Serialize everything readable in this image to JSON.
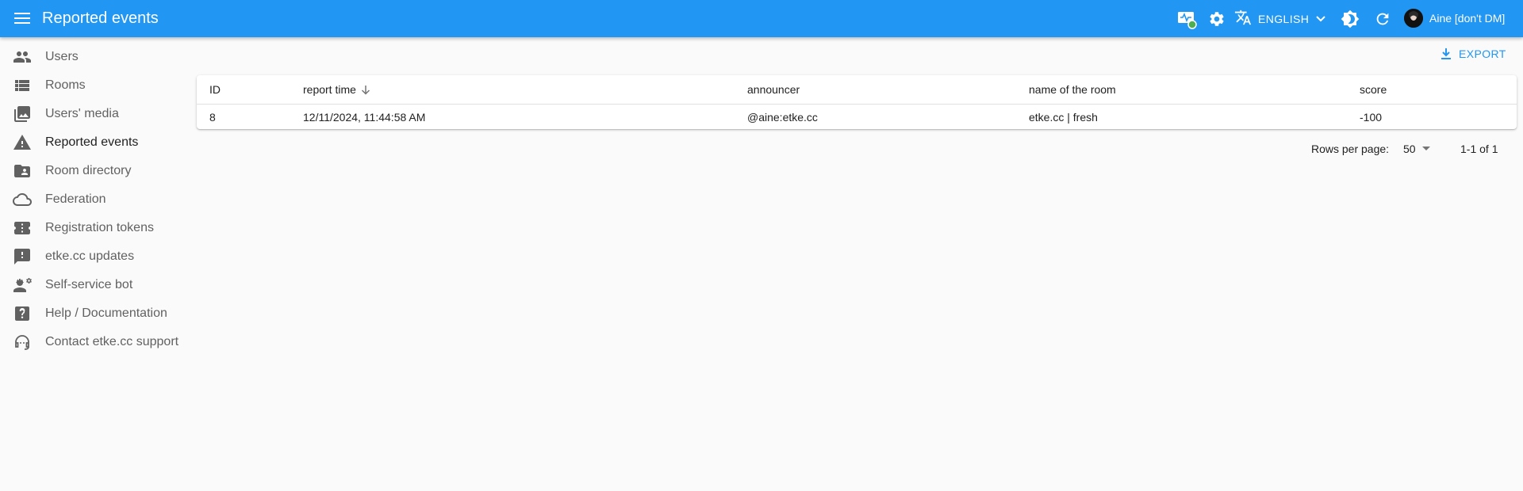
{
  "appbar": {
    "title": "Reported events",
    "language": "ENGLISH",
    "user_name": "Aine [don't DM]",
    "icons": [
      "menu-icon",
      "server-status-icon",
      "settings-icon",
      "translate-icon",
      "chevron-down-icon",
      "theme-toggle-icon",
      "refresh-icon"
    ]
  },
  "sidebar": {
    "items": [
      {
        "label": "Users",
        "icon": "users-icon"
      },
      {
        "label": "Rooms",
        "icon": "list-icon"
      },
      {
        "label": "Users' media",
        "icon": "photo-library-icon"
      },
      {
        "label": "Reported events",
        "icon": "warning-icon",
        "active": true
      },
      {
        "label": "Room directory",
        "icon": "folder-shared-icon"
      },
      {
        "label": "Federation",
        "icon": "cloud-icon"
      },
      {
        "label": "Registration tokens",
        "icon": "ticket-icon"
      },
      {
        "label": "etke.cc updates",
        "icon": "feedback-icon"
      },
      {
        "label": "Self-service bot",
        "icon": "engineering-icon"
      },
      {
        "label": "Help / Documentation",
        "icon": "help-icon"
      },
      {
        "label": "Contact etke.cc support",
        "icon": "support-agent-icon"
      }
    ]
  },
  "toolbar": {
    "export_label": "EXPORT"
  },
  "table": {
    "columns": [
      "ID",
      "report time",
      "announcer",
      "name of the room",
      "score"
    ],
    "rows": [
      {
        "id": "8",
        "report_time": "12/11/2024, 11:44:58 AM",
        "announcer": "@aine:etke.cc",
        "room_name": "etke.cc | fresh",
        "score": "-100"
      }
    ]
  },
  "pagination": {
    "rows_per_page_label": "Rows per page:",
    "rows_per_page": "50",
    "range": "1-1 of 1"
  },
  "colors": {
    "primary": "#2196f3",
    "background": "#fafafa",
    "status_dot": "#4caf50"
  }
}
